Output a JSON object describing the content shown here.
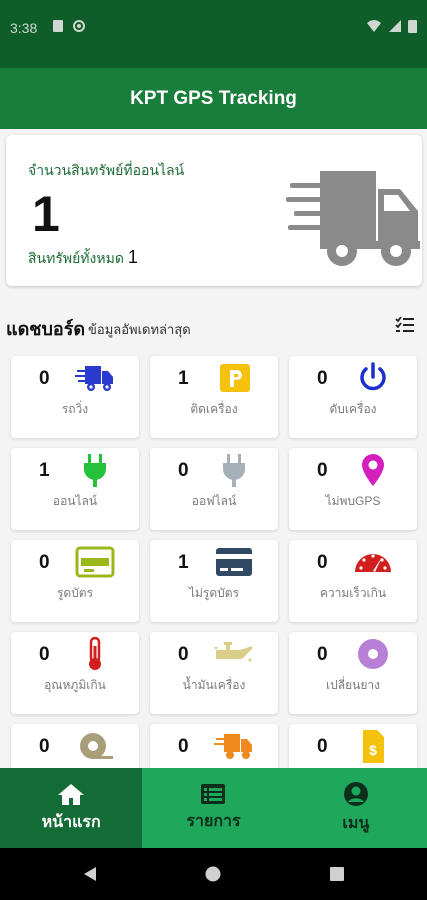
{
  "status": {
    "time": "3:38"
  },
  "app": {
    "title": "KPT GPS Tracking"
  },
  "summary": {
    "online_label": "จำนวนสินทรัพย์ที่ออนไลน์",
    "online_count": "1",
    "total_label": "สินทรัพย์ทั้งหมด",
    "total_count": "1"
  },
  "dashboard": {
    "title": "แดชบอร์ด",
    "subtitle": "ข้อมูลอัพเดทล่าสุด",
    "tiles": [
      {
        "count": "0",
        "label": "รถวิ่ง",
        "icon": "moving-truck-icon"
      },
      {
        "count": "1",
        "label": "ติดเครื่อง",
        "icon": "parking-icon"
      },
      {
        "count": "0",
        "label": "ดับเครื่อง",
        "icon": "power-icon"
      },
      {
        "count": "1",
        "label": "ออนไลน์",
        "icon": "plug-online-icon"
      },
      {
        "count": "0",
        "label": "ออฟไลน์",
        "icon": "plug-offline-icon"
      },
      {
        "count": "0",
        "label": "ไม่พบGPS",
        "icon": "location-pin-icon"
      },
      {
        "count": "0",
        "label": "รูดบัตร",
        "icon": "card-swiped-icon"
      },
      {
        "count": "1",
        "label": "ไม่รูดบัตร",
        "icon": "card-not-swiped-icon"
      },
      {
        "count": "0",
        "label": "ความเร็วเกิน",
        "icon": "speedometer-icon"
      },
      {
        "count": "0",
        "label": "อุณหภูมิเกิน",
        "icon": "thermometer-icon"
      },
      {
        "count": "0",
        "label": "น้ำมันเครื่อง",
        "icon": "oil-can-icon"
      },
      {
        "count": "0",
        "label": "เปลี่ยนยาง",
        "icon": "tire-icon"
      },
      {
        "count": "0",
        "label": "",
        "icon": "tape-icon"
      },
      {
        "count": "0",
        "label": "",
        "icon": "delivery-truck-icon"
      },
      {
        "count": "0",
        "label": "",
        "icon": "invoice-icon"
      }
    ]
  },
  "nav": {
    "home": "หน้าแรก",
    "list": "รายการ",
    "menu": "เมนู"
  },
  "colors": {
    "primary": "#197d3b",
    "accent": "#1fa75c"
  }
}
